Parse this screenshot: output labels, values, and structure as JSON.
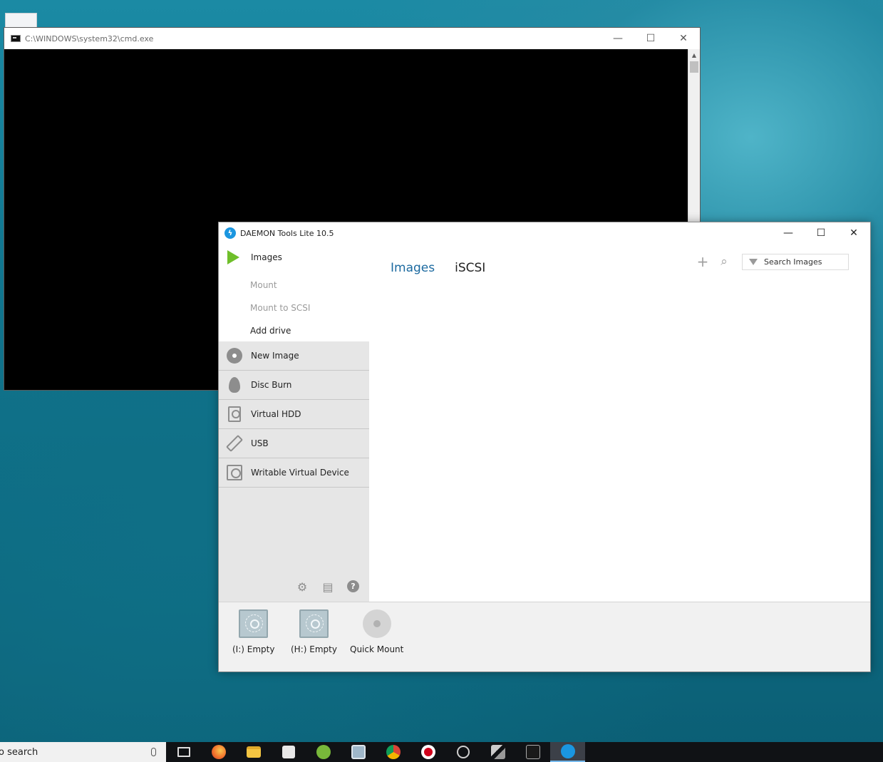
{
  "desktop": {
    "cmd_window": {
      "title": "C:\\WINDOWS\\system32\\cmd.exe",
      "minimize": "—",
      "maximize": "☐",
      "close": "✕"
    },
    "daemon_window": {
      "title": "DAEMON Tools Lite 10.5",
      "minimize": "—",
      "maximize": "☐",
      "close": "✕",
      "accent_color": "#1c6aa0",
      "sidebar": {
        "images_label": "Images",
        "sub_items": [
          {
            "label": "Mount",
            "enabled": false
          },
          {
            "label": "Mount to SCSI",
            "enabled": false
          },
          {
            "label": "Add drive",
            "enabled": true
          }
        ],
        "items": [
          {
            "label": "New Image",
            "icon": "disc-icon"
          },
          {
            "label": "Disc Burn",
            "icon": "flame-icon"
          },
          {
            "label": "Virtual HDD",
            "icon": "hdd-icon"
          },
          {
            "label": "USB",
            "icon": "usb-icon"
          },
          {
            "label": "Writable Virtual Device",
            "icon": "writable-device-icon"
          }
        ],
        "footer_icons": [
          "gear-icon",
          "news-icon",
          "help-icon"
        ]
      },
      "tabs": [
        {
          "label": "Images",
          "active": true
        },
        {
          "label": "iSCSI",
          "active": false
        }
      ],
      "toolbar": {
        "add_icon": "+",
        "search_icon": "⌕",
        "search_placeholder": "Search Images"
      },
      "drives": [
        {
          "label": "(I:) Empty"
        },
        {
          "label": "(H:) Empty"
        }
      ],
      "quick_mount_label": "Quick Mount"
    }
  },
  "taskbar": {
    "search_text": "o search",
    "apps": [
      "task-view",
      "firefox",
      "file-explorer",
      "store",
      "utorrent",
      "photos",
      "chrome",
      "recorder",
      "spiral-app",
      "tool-app",
      "console",
      "daemon-tools"
    ],
    "active_app": "daemon-tools"
  }
}
